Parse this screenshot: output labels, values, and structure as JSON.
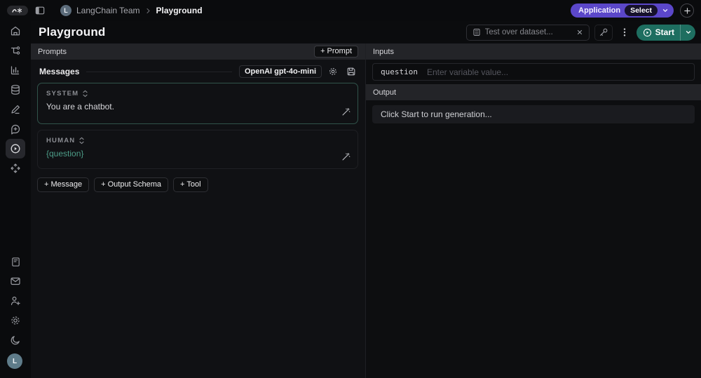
{
  "colors": {
    "accent_purple": "#5b47c9",
    "accent_teal": "#1e6e60",
    "variable_teal": "#4d9d88",
    "system_card_border": "#31544b"
  },
  "topbar": {
    "team_avatar_letter": "L",
    "team_name": "LangChain Team",
    "breadcrumb_page": "Playground",
    "application_label": "Application",
    "select_label": "Select"
  },
  "header": {
    "title": "Playground",
    "dataset_search_placeholder": "Test over dataset...",
    "start_label": "Start"
  },
  "sidebar": {
    "avatar_letter": "L"
  },
  "prompts_panel": {
    "header_label": "Prompts",
    "add_prompt_label": "+ Prompt",
    "messages_label": "Messages",
    "model_label": "OpenAI gpt-4o-mini",
    "messages": [
      {
        "role": "SYSTEM",
        "content": "You are a chatbot."
      },
      {
        "role": "HUMAN",
        "content": "{question}"
      }
    ],
    "footer_buttons": [
      "+ Message",
      "+ Output Schema",
      "+ Tool"
    ]
  },
  "io_panel": {
    "inputs_header": "Inputs",
    "variable_name": "question",
    "variable_placeholder": "Enter variable value...",
    "output_header": "Output",
    "output_placeholder": "Click Start to run generation..."
  }
}
